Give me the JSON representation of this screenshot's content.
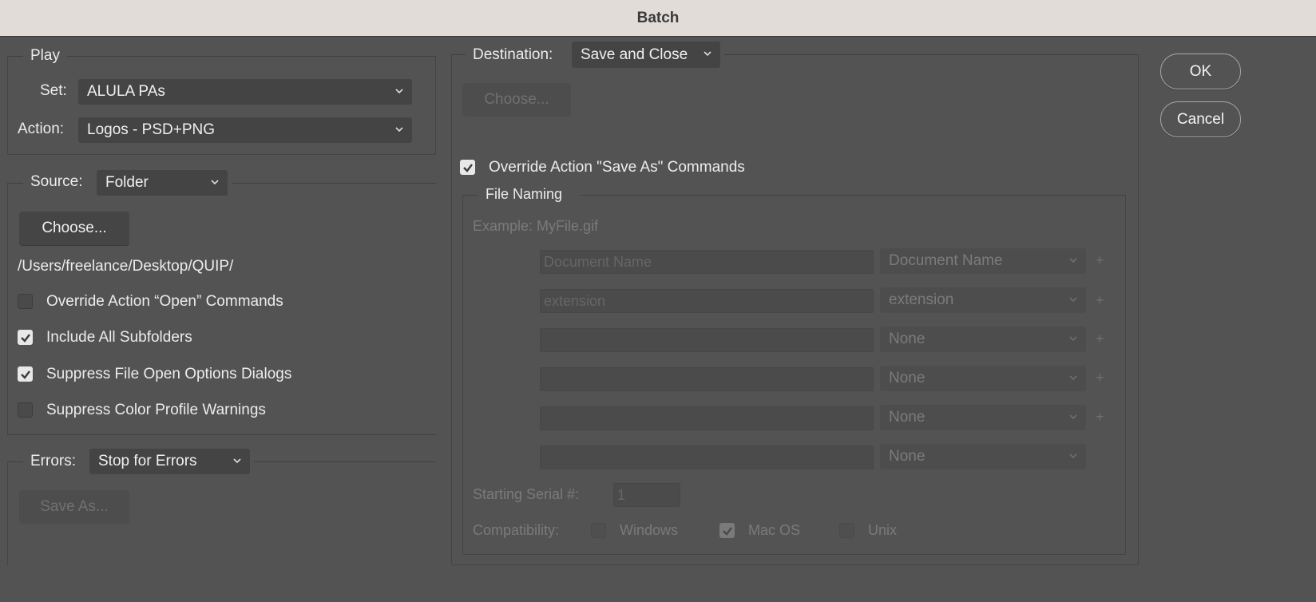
{
  "window": {
    "title": "Batch"
  },
  "play": {
    "group_label": "Play",
    "set_label": "Set:",
    "set_value": "ALULA PAs",
    "action_label": "Action:",
    "action_value": "Logos - PSD+PNG"
  },
  "source": {
    "label": "Source:",
    "value": "Folder",
    "choose_label": "Choose...",
    "path": "/Users/freelance/Desktop/QUIP/",
    "options": [
      {
        "label": "Override Action “Open” Commands",
        "checked": false
      },
      {
        "label": "Include All Subfolders",
        "checked": true
      },
      {
        "label": "Suppress File Open Options Dialogs",
        "checked": true
      },
      {
        "label": "Suppress Color Profile Warnings",
        "checked": false
      }
    ]
  },
  "errors": {
    "label": "Errors:",
    "value": "Stop for Errors",
    "save_as_label": "Save As..."
  },
  "destination": {
    "label": "Destination:",
    "value": "Save and Close",
    "choose_label": "Choose...",
    "override_label": "Override Action \"Save As\" Commands",
    "override_checked": true
  },
  "file_naming": {
    "group_label": "File Naming",
    "example": "Example: MyFile.gif",
    "rows": [
      {
        "field": "Document Name",
        "select": "Document Name",
        "plus": "+"
      },
      {
        "field": "extension",
        "select": "extension",
        "plus": "+"
      },
      {
        "field": "",
        "select": "None",
        "plus": "+"
      },
      {
        "field": "",
        "select": "None",
        "plus": "+"
      },
      {
        "field": "",
        "select": "None",
        "plus": "+"
      },
      {
        "field": "",
        "select": "None",
        "plus": ""
      }
    ],
    "serial_label": "Starting Serial #:",
    "serial_value": "1",
    "compat_label": "Compatibility:",
    "compat": [
      {
        "label": "Windows",
        "checked": false
      },
      {
        "label": "Mac OS",
        "checked": true
      },
      {
        "label": "Unix",
        "checked": false
      }
    ]
  },
  "buttons": {
    "ok": "OK",
    "cancel": "Cancel"
  },
  "icons": {
    "dropdown": "chevron-down-icon",
    "check": "checkmark-icon"
  }
}
